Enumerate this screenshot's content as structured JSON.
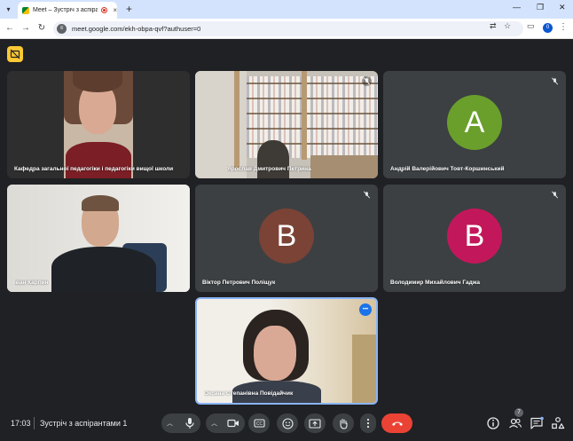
{
  "browser": {
    "tab_title": "Meet – Зустріч з аспірантами",
    "tab_close": "×",
    "new_tab": "+",
    "url": "meet.google.com/ekh-obpa-qvf?authuser=0",
    "profile_initial": "0"
  },
  "meet": {
    "participants": [
      {
        "name": "Кафедра загальної педагогіки і педагогіки вищої школи",
        "tile": "video"
      },
      {
        "name": "Ярослав Дмитрович Петрина",
        "tile": "video",
        "muted": true
      },
      {
        "name": "Андрій Валерійович Товт-Коршинський",
        "tile": "avatar",
        "initial": "A",
        "color": "#6a9f2c",
        "muted": true
      },
      {
        "name": "Іван Карпин",
        "tile": "video"
      },
      {
        "name": "Віктор Петрович Поліщук",
        "tile": "avatar",
        "initial": "B",
        "color": "#7a4336",
        "muted": true
      },
      {
        "name": "Володимир Михайлович Гаджа",
        "tile": "avatar",
        "initial": "B",
        "color": "#c2185b",
        "muted": true
      },
      {
        "name": "Оксана Степанівна Повідайчик",
        "tile": "video",
        "speaking": true
      }
    ],
    "more_options": "•••"
  },
  "bottom_bar": {
    "time": "17:03",
    "meeting_title": "Зустріч з аспірантами 1",
    "participant_count": "7",
    "leave_color": "#ea4335"
  }
}
